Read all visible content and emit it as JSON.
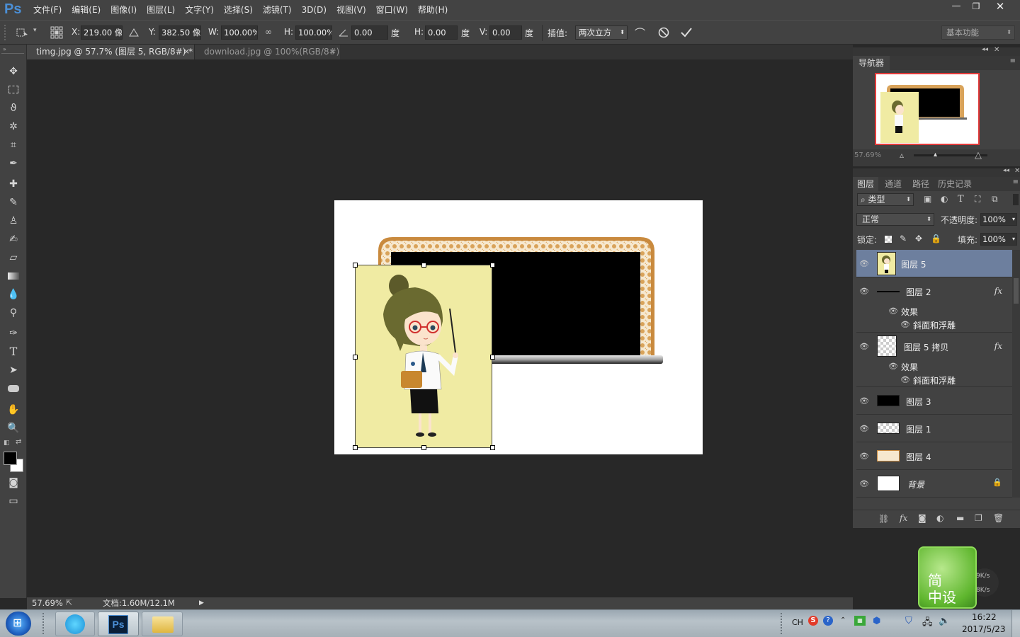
{
  "app": {
    "logo": "Ps"
  },
  "menu": [
    "文件(F)",
    "编辑(E)",
    "图像(I)",
    "图层(L)",
    "文字(Y)",
    "选择(S)",
    "滤镜(T)",
    "3D(D)",
    "视图(V)",
    "窗口(W)",
    "帮助(H)"
  ],
  "options": {
    "x_label": "X:",
    "x_value": "219.00 像素",
    "y_label": "Y:",
    "y_value": "382.50 像素",
    "w_label": "W:",
    "w_value": "100.00%",
    "h_label": "H:",
    "h_value": "100.00%",
    "angle_value": "0.00",
    "angle_unit": "度",
    "hskew_label": "H:",
    "hskew_value": "0.00",
    "hskew_unit": "度",
    "vskew_label": "V:",
    "vskew_value": "0.00",
    "vskew_unit": "度",
    "interp_label": "插值:",
    "interp_value": "两次立方",
    "workspace": "基本功能"
  },
  "tabs": [
    {
      "label": "timg.jpg @ 57.7% (图层 5, RGB/8#) *",
      "close": "×",
      "active": true
    },
    {
      "label": "download.jpg @ 100%(RGB/8#)",
      "close": "×",
      "active": false
    }
  ],
  "status": {
    "zoom": "57.69%",
    "doc": "文档:1.60M/12.1M"
  },
  "navigator": {
    "title": "导航器",
    "zoom": "57.69%"
  },
  "layers_panel": {
    "tabs": [
      "图层",
      "通道",
      "路径",
      "历史记录"
    ],
    "filter": "类型",
    "blend": "正常",
    "opacity_label": "不透明度:",
    "opacity": "100%",
    "lock_label": "锁定:",
    "fill_label": "填充:",
    "fill": "100%",
    "layers": [
      {
        "name": "图层 5"
      },
      {
        "name": "图层 2",
        "fx": "fx",
        "effects_label": "效果",
        "effect": "斜面和浮雕"
      },
      {
        "name": "图层 5 拷贝",
        "fx": "fx",
        "effects_label": "效果",
        "effect": "斜面和浮雕"
      },
      {
        "name": "图层 3"
      },
      {
        "name": "图层 1"
      },
      {
        "name": "图层 4"
      },
      {
        "name": "背景"
      }
    ]
  },
  "widget": {
    "line1": "简",
    "line2": "中设",
    "up": "9K/s",
    "down": "8K/s"
  },
  "taskbar": {
    "ime": "CH",
    "time": "16:22",
    "date": "2017/5/23"
  },
  "colors": {
    "ui_bg": "#424242",
    "canvas_bg": "#282828",
    "selected_layer": "#6d7f9e",
    "ps_blue": "#4b8fd6",
    "figure_bg": "#f0eba3"
  }
}
